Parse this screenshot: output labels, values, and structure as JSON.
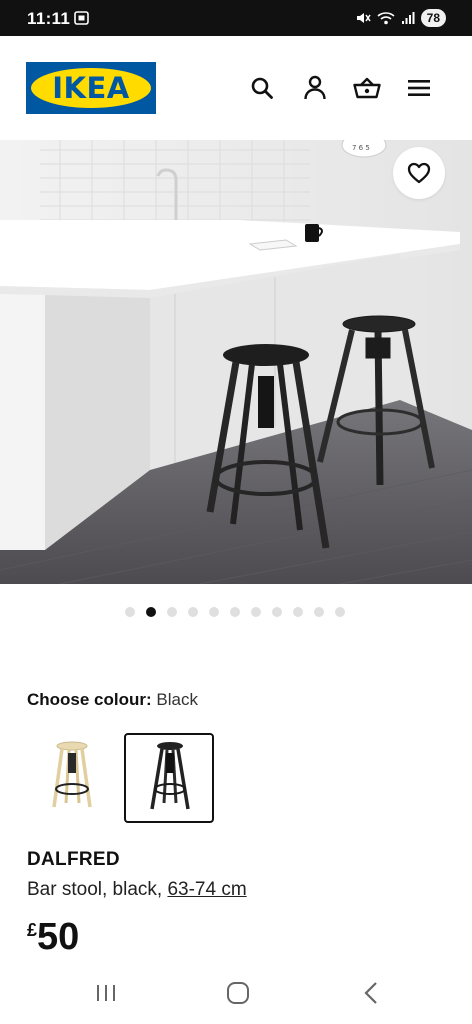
{
  "status_bar": {
    "time": "11:11",
    "battery": "78",
    "icons": [
      "screenshot-icon",
      "mute-icon",
      "wifi-icon",
      "signal-icon"
    ]
  },
  "header": {
    "logo_text": "IKEA",
    "icons": [
      "search-icon",
      "profile-icon",
      "basket-icon",
      "menu-icon"
    ],
    "brand_colors": {
      "blue": "#0058a3",
      "yellow": "#ffdb00"
    }
  },
  "gallery": {
    "favourite_icon": "heart-icon",
    "image_count": 11,
    "active_index": 1
  },
  "colour_picker": {
    "label": "Choose colour:",
    "selected": "Black",
    "options": [
      "natural-stool",
      "black-stool"
    ]
  },
  "product": {
    "name": "DALFRED",
    "description": "Bar stool, black, ",
    "size": "63-74 cm",
    "price_currency": "£",
    "price_amount": "50"
  },
  "nav_bar": {
    "icons": [
      "recent-apps-icon",
      "home-icon",
      "back-icon"
    ]
  }
}
